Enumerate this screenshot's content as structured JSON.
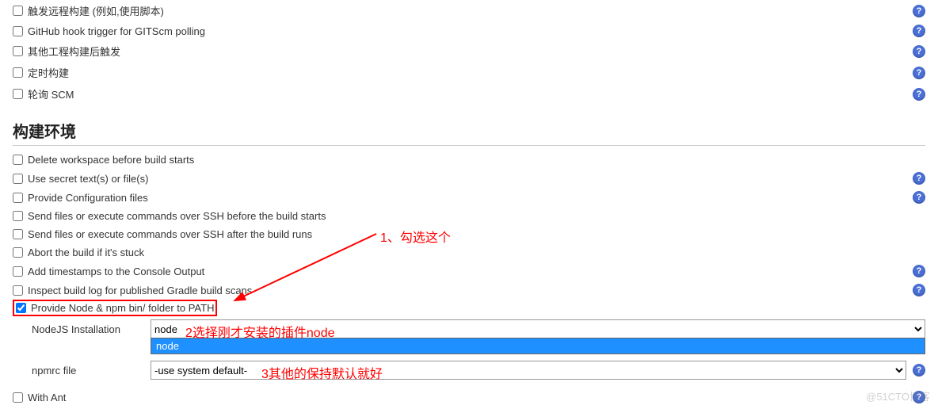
{
  "triggers": {
    "t0": "触发远程构建 (例如,使用脚本)",
    "t1": "GitHub hook trigger for GITScm polling",
    "t2": "其他工程构建后触发",
    "t3": "定时构建",
    "t4": "轮询 SCM"
  },
  "sectionTitle": "构建环境",
  "env": {
    "e0": "Delete workspace before build starts",
    "e1": "Use secret text(s) or file(s)",
    "e2": "Provide Configuration files",
    "e3": "Send files or execute commands over SSH before the build starts",
    "e4": "Send files or execute commands over SSH after the build runs",
    "e5": "Abort the build if it's stuck",
    "e6": "Add timestamps to the Console Output",
    "e7": "Inspect build log for published Gradle build scans",
    "e8": "Provide Node & npm bin/ folder to PATH",
    "e9": "With Ant"
  },
  "nodejs": {
    "label": "NodeJS Installation",
    "selected": "node",
    "option": "node"
  },
  "npmrc": {
    "label": "npmrc file",
    "selected": "-use system default-"
  },
  "annotations": {
    "a1": "1、勾选这个",
    "a2": "2选择刚才安装的插件node",
    "a3": "3其他的保持默认就好"
  },
  "watermark": "@51CTO博客"
}
